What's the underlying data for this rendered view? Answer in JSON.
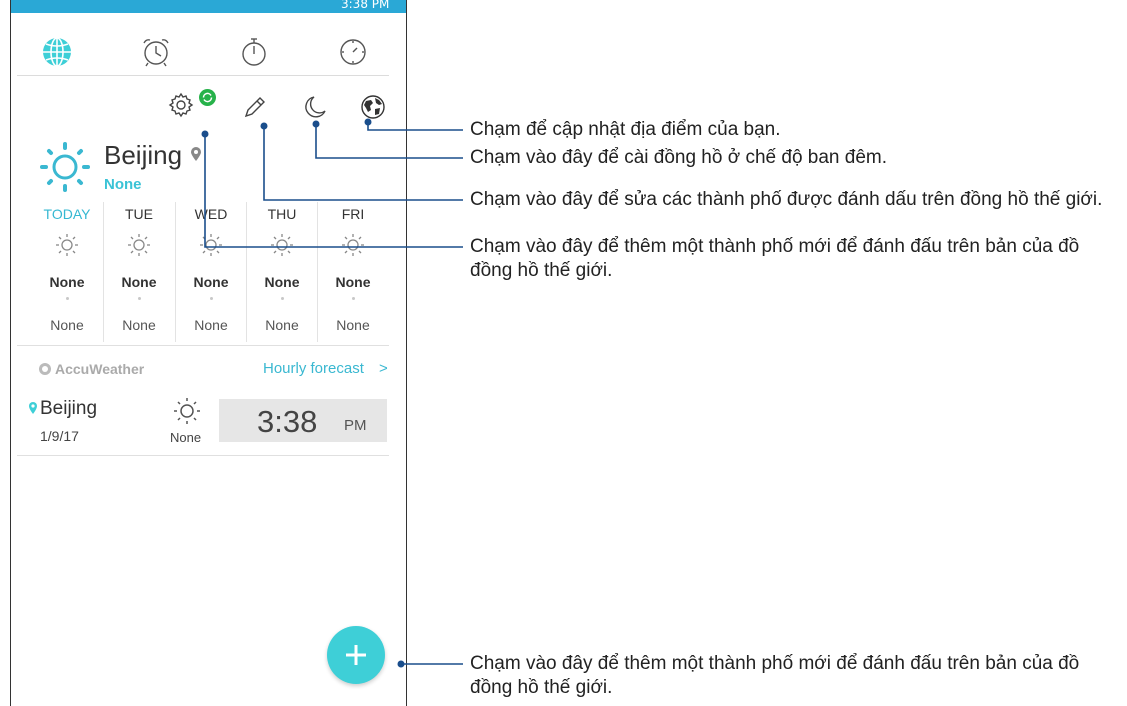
{
  "status_bar": {
    "time": "3:38 PM"
  },
  "tabs": [
    {
      "name": "world-clock",
      "icon": "globe-icon",
      "active": true
    },
    {
      "name": "alarm",
      "icon": "alarm-clock-icon",
      "active": false
    },
    {
      "name": "stopwatch",
      "icon": "stopwatch-icon",
      "active": false
    },
    {
      "name": "timer",
      "icon": "timer-icon",
      "active": false
    }
  ],
  "toolbar": [
    "settings-icon",
    "edit-icon",
    "night-mode-icon",
    "world-map-icon"
  ],
  "current": {
    "city": "Beijing",
    "condition": "None"
  },
  "forecast": [
    {
      "day": "TODAY",
      "high": "None",
      "low": "None"
    },
    {
      "day": "TUE",
      "high": "None",
      "low": "None"
    },
    {
      "day": "WED",
      "high": "None",
      "low": "None"
    },
    {
      "day": "THU",
      "high": "None",
      "low": "None"
    },
    {
      "day": "FRI",
      "high": "None",
      "low": "None"
    }
  ],
  "provider": "AccuWeather",
  "hourly_forecast": "Hourly forecast",
  "hourly_chevron": ">",
  "world_clock": {
    "city": "Beijing",
    "date": "1/9/17",
    "condition": "None",
    "time": "3:38",
    "ampm": "PM"
  },
  "callouts": [
    "Chạm để cập nhật địa điểm của bạn.",
    "Chạm vào đây để cài đồng hồ ở chế độ ban đêm.",
    "Chạm vào đây để sửa các thành phố được đánh dấu trên đồng hồ thế giới.",
    "Chạm vào đây để thêm một thành phố mới để đánh đấu trên bản của đồ đồng hồ thế giới.",
    "Chạm vào đây để thêm một thành phố mới để đánh đấu trên bản của đồ đồng hồ thế giới."
  ],
  "colors": {
    "accent": "#3ecfd7",
    "today": "#35b8d2",
    "sync": "#27b24a",
    "line": "#1a4e8c"
  }
}
